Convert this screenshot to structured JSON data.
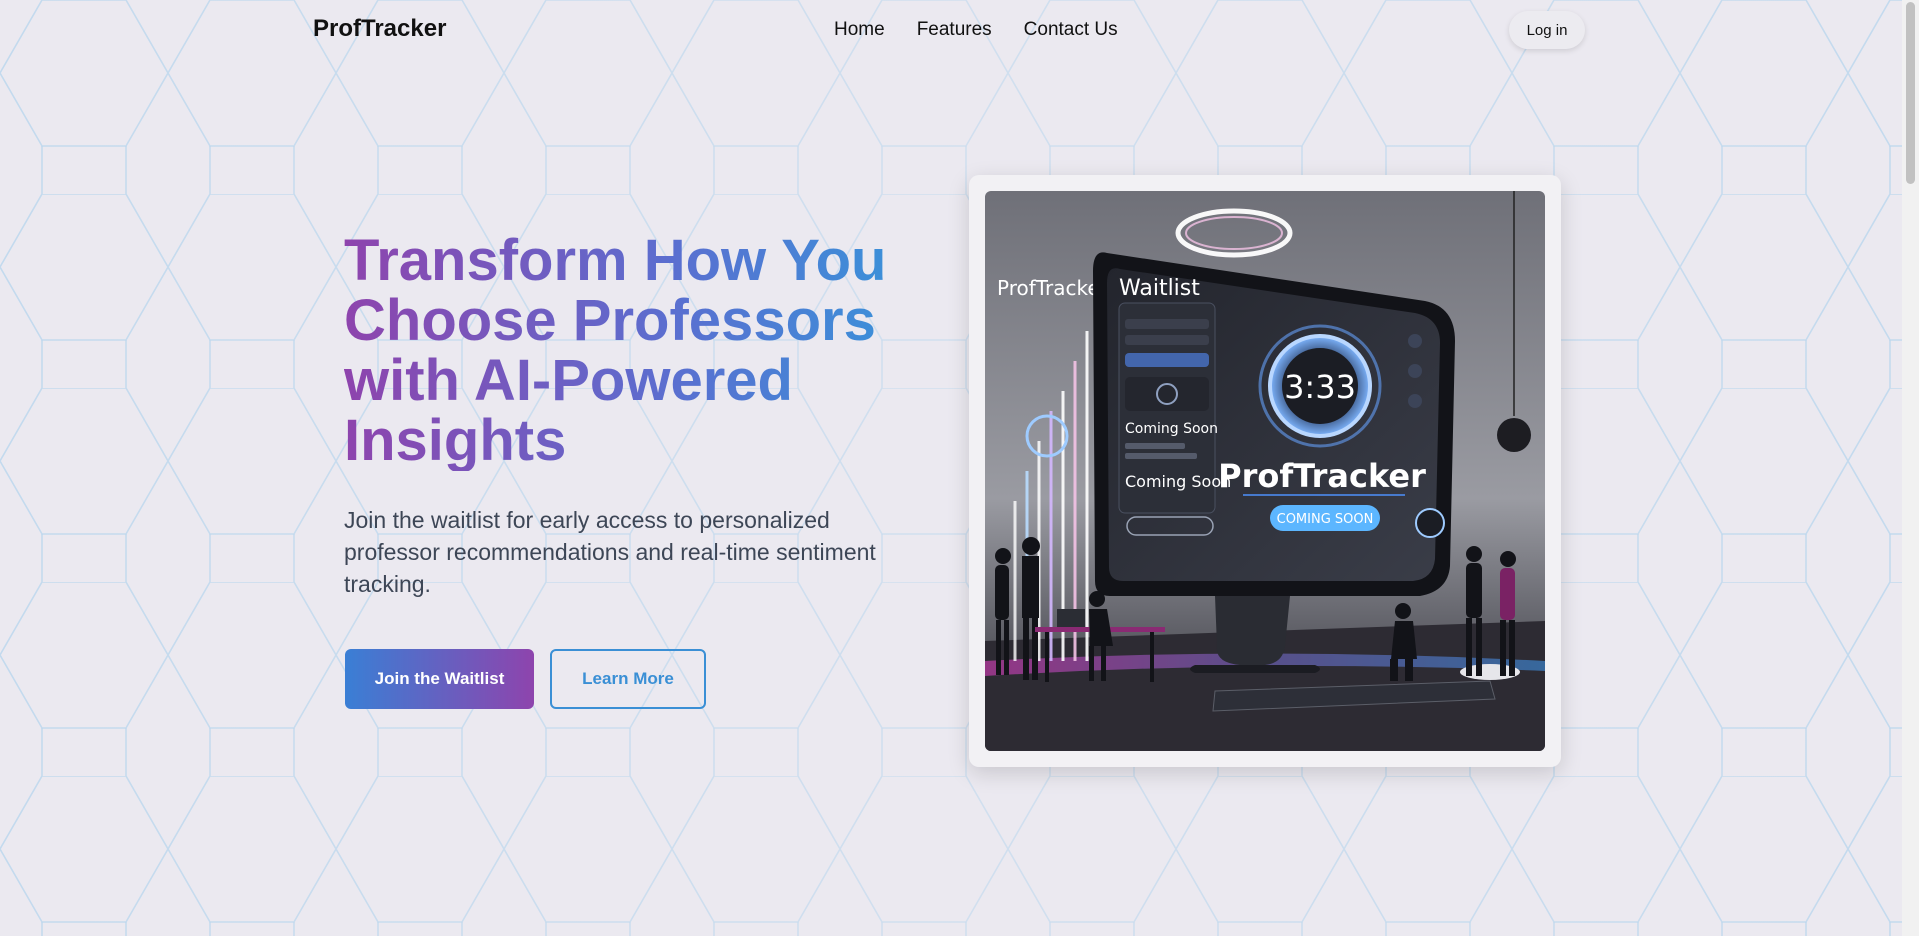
{
  "brand": {
    "name": "ProfTracker"
  },
  "nav": {
    "links": [
      "Home",
      "Features",
      "Contact Us"
    ],
    "login_label": "Log in"
  },
  "hero": {
    "title": "Transform How You Choose Professors with AI-Powered Insights",
    "subtitle": "Join the waitlist for early access to personalized professor recommendations and real-time sentiment tracking.",
    "primary_cta": "Join the Waitlist",
    "secondary_cta": "Learn More"
  },
  "hero_image": {
    "logo_text": "ProfTracker",
    "panel_title": "Waitlist",
    "coming_soon_1": "Coming Soon",
    "coming_soon_2": "Coming Soon",
    "clock": "3:33",
    "screen_brand": "ProfTracker",
    "screen_badge": "COMING SOON"
  },
  "colors": {
    "gradient_start": "#8e44ad",
    "gradient_end": "#3498db",
    "secondary_button": "#3a8fd5",
    "page_background": "#ebe9f0"
  },
  "icons": [
    "hexagon-pattern-background",
    "scrollbar"
  ]
}
